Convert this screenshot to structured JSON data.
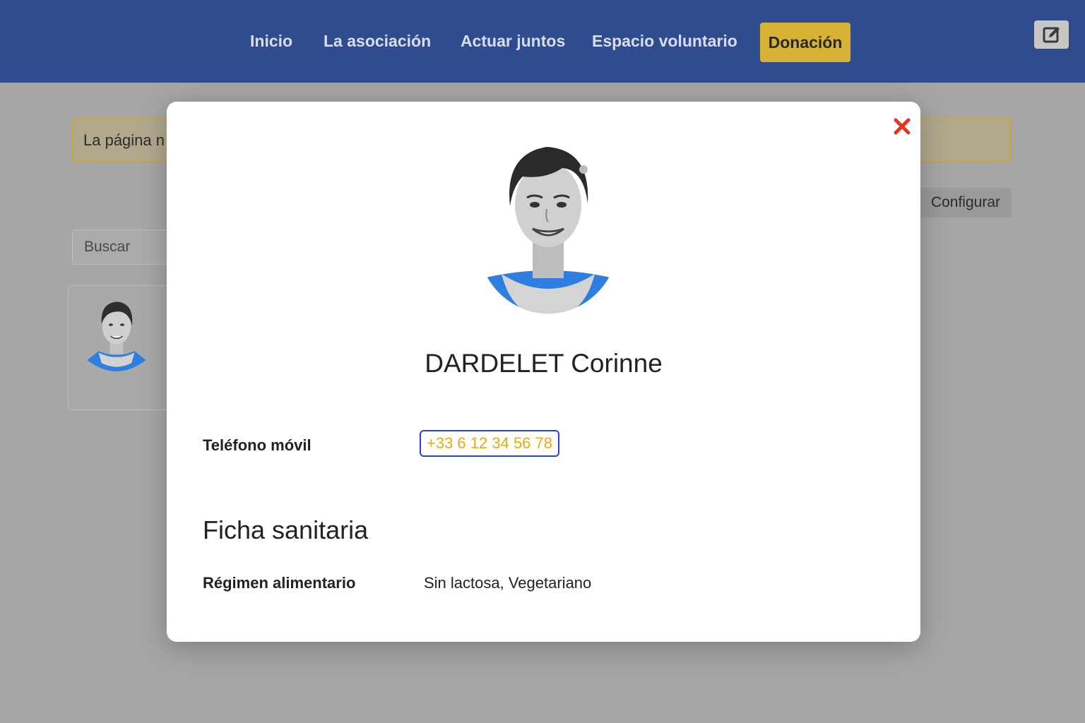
{
  "nav": {
    "items": [
      "Inicio",
      "La asociación",
      "Actuar juntos",
      "Espacio voluntario"
    ],
    "donate_label": "Donación"
  },
  "page": {
    "notice_text": "La página n",
    "configure_label": "Configurar",
    "search_placeholder": "Buscar"
  },
  "modal": {
    "name": "DARDELET Corinne",
    "phone_label": "Teléfono móvil",
    "phone_value": "+33 6 12 34 56 78",
    "section_title": "Ficha sanitaria",
    "diet_label": "Régimen alimentario",
    "diet_value": "Sin lactosa, Vegetariano"
  },
  "colors": {
    "header": "#2f4c8e",
    "donate": "#d8b234",
    "close": "#e03525",
    "phone_text": "#e3ac10",
    "phone_border": "#2345d6",
    "shirt": "#2f7fe0"
  },
  "icons": {
    "edit": "edit-icon",
    "close": "close-icon"
  }
}
